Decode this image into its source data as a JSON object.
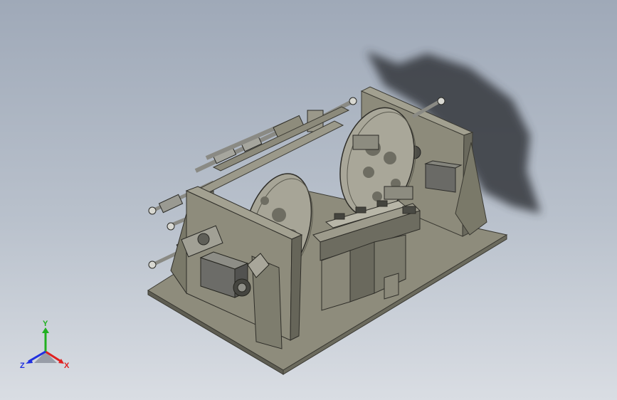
{
  "viewport": {
    "background_top": "#9fa9b8",
    "background_bottom": "#d9dde3",
    "model_color": "#8f8d7d",
    "model_dark": "#5f5e52",
    "shadow_color": "#3c3e44"
  },
  "triad": {
    "x_label": "X",
    "y_label": "Y",
    "z_label": "Z",
    "x_color": "#e02020",
    "y_color": "#20b020",
    "z_color": "#2030e0"
  }
}
